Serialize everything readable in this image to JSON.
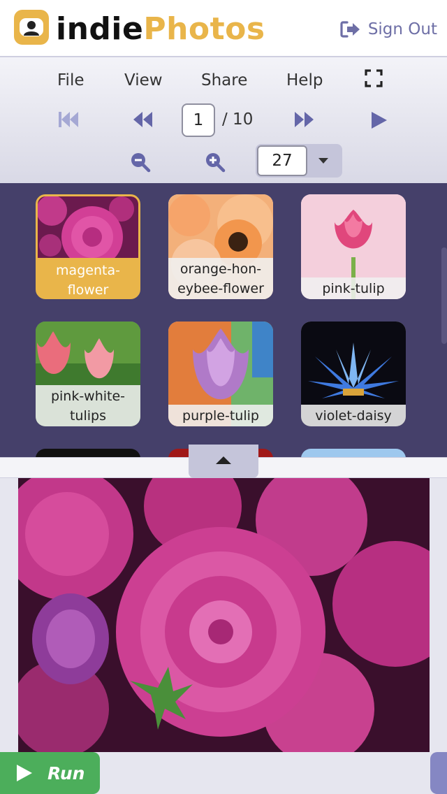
{
  "app": {
    "brand_part1": "indie",
    "brand_part2": "Photos",
    "brand_color": "#e9b54a",
    "logo_icon": "user-badge-icon"
  },
  "header": {
    "sign_out_label": "Sign Out",
    "sign_out_icon": "sign-out-icon",
    "accent_color": "#6e6fa6"
  },
  "menu": {
    "file": "File",
    "view": "View",
    "share": "Share",
    "help": "Help",
    "fullscreen_icon": "fullscreen-icon"
  },
  "pager": {
    "first_icon": "skip-to-first-icon",
    "prev_icon": "rewind-icon",
    "current_page": "1",
    "total_label": "/ 10",
    "next_icon": "fast-forward-icon",
    "play_icon": "play-icon"
  },
  "zoom": {
    "zoom_out_icon": "zoom-out-icon",
    "zoom_in_icon": "zoom-in-icon",
    "value": "27",
    "dropdown_icon": "caret-down-icon"
  },
  "gallery": {
    "items": [
      {
        "label": "magenta-\nflower",
        "selected": true
      },
      {
        "label": "orange-hon-\neybee-flower",
        "selected": false
      },
      {
        "label": "pink-tulip",
        "selected": false
      },
      {
        "label": "pink-white-\ntulips",
        "selected": false
      },
      {
        "label": "purple-tulip",
        "selected": false
      },
      {
        "label": "violet-daisy",
        "selected": false
      }
    ],
    "background": "#45406a"
  },
  "divider": {
    "collapse_icon": "caret-up-icon"
  },
  "preview": {
    "image": "magenta-flower"
  },
  "footer": {
    "run_label": "Run",
    "run_icon": "play-icon",
    "run_color": "#4cae5b"
  }
}
